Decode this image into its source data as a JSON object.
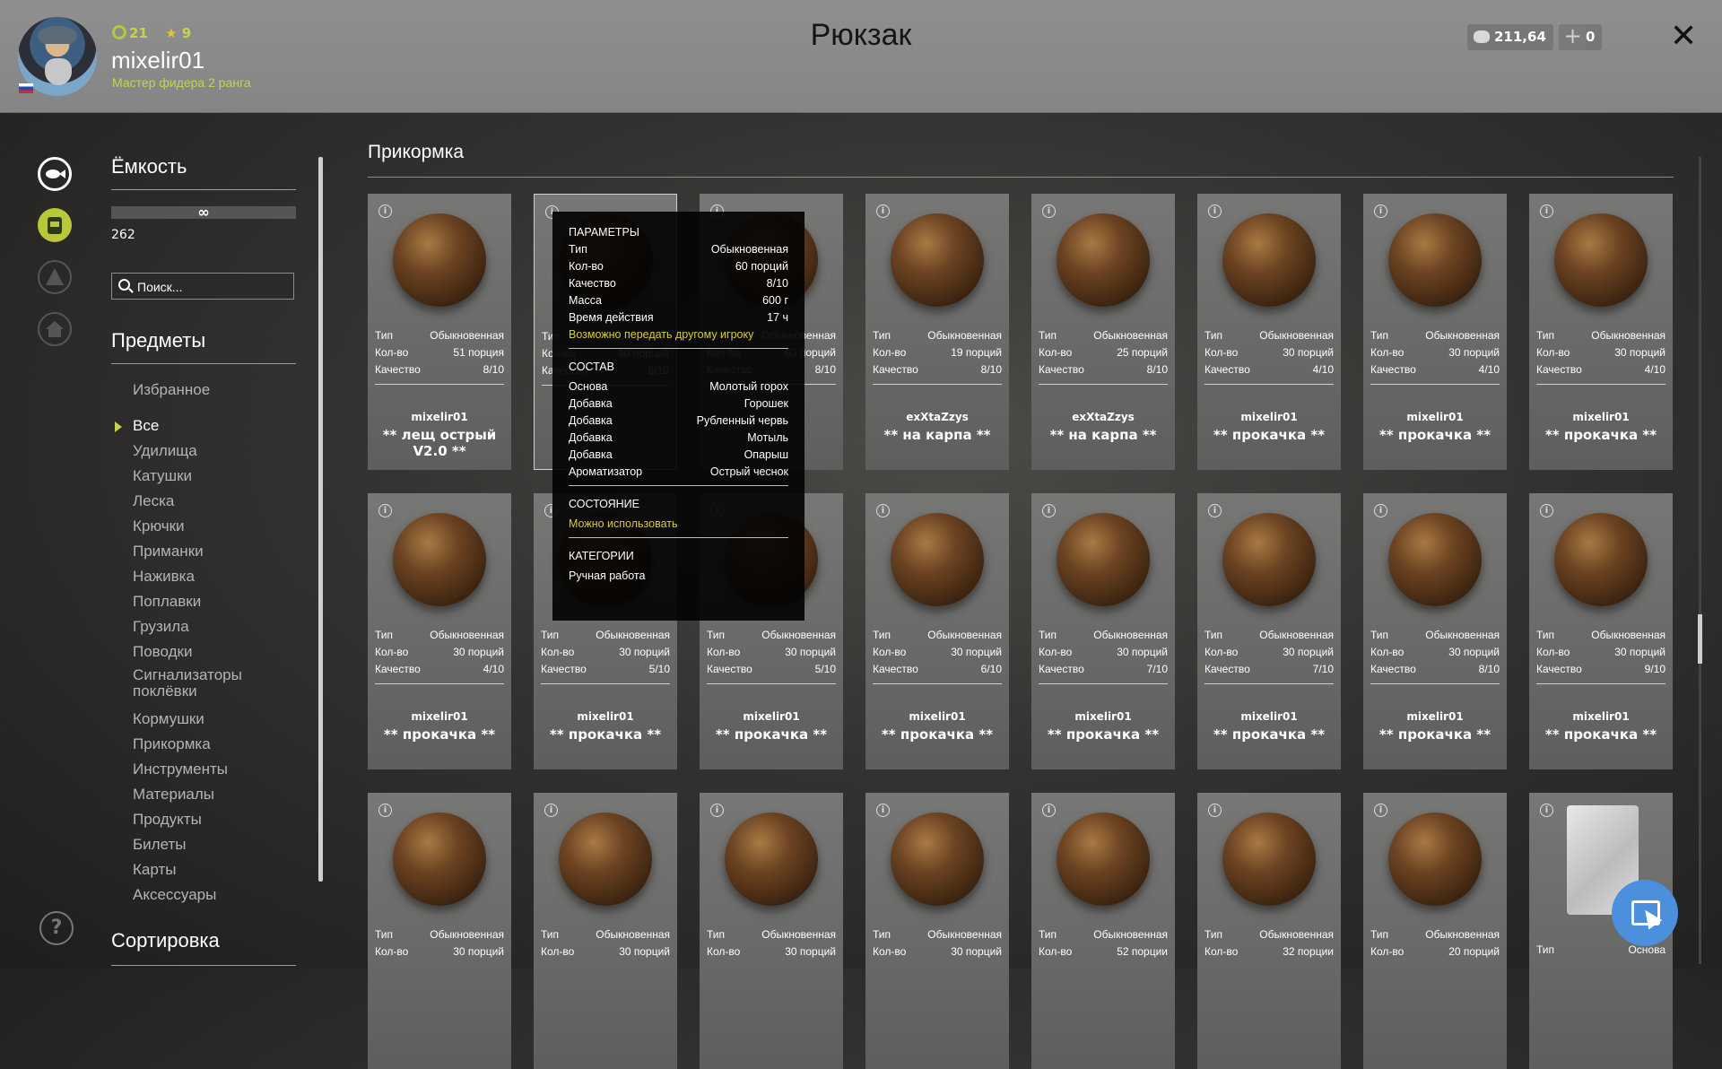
{
  "header": {
    "title": "Рюкзак",
    "level": "21",
    "stars": "9",
    "username": "mixelir01",
    "rank": "Мастер фидера 2 ранга",
    "silver": "211,64",
    "gold": "0",
    "plus_symbol": "+",
    "close_symbol": "✕",
    "colors": {
      "accent": "#c8d24b",
      "topbar": "#8a8a8a"
    }
  },
  "left_icons": [
    "fish-icon",
    "backpack-icon",
    "camp-icon",
    "home-icon"
  ],
  "sidebar": {
    "capacity_label": "Ёмкость",
    "capacity_infinity": "∞",
    "capacity_value": "262",
    "search_placeholder": "Поиск...",
    "items_label": "Предметы",
    "categories": [
      "Избранное",
      "Все",
      "Удилища",
      "Катушки",
      "Леска",
      "Крючки",
      "Приманки",
      "Наживка",
      "Поплавки",
      "Грузила",
      "Поводки",
      "Сигнализаторы поклёвки",
      "Кормушки",
      "Прикормка",
      "Инструменты",
      "Материалы",
      "Продукты",
      "Билеты",
      "Карты",
      "Аксессуары"
    ],
    "active_category": "Все",
    "sort_label": "Сортировка",
    "help_symbol": "?"
  },
  "section": {
    "title": "Прикормка"
  },
  "labels": {
    "type": "Тип",
    "count": "Кол-во",
    "quality": "Качество",
    "base": "Основа",
    "info": "i"
  },
  "cards": [
    {
      "type": "Обыкновенная",
      "count": "51 порция",
      "quality": "8/10",
      "author": "mixelir01",
      "name": "** лещ острый V2.0 **"
    },
    {
      "type": "Обыкновенная",
      "count": "60 порций",
      "quality": "8/10",
      "author": "",
      "name": ""
    },
    {
      "type": "Обыкновенная",
      "count": "60 порций",
      "quality": "8/10",
      "author": "",
      "name": "**"
    },
    {
      "type": "Обыкновенная",
      "count": "19 порций",
      "quality": "8/10",
      "author": "exXtaZzys",
      "name": "** на карпа **"
    },
    {
      "type": "Обыкновенная",
      "count": "25 порций",
      "quality": "8/10",
      "author": "exXtaZzys",
      "name": "** на карпа **"
    },
    {
      "type": "Обыкновенная",
      "count": "30 порций",
      "quality": "4/10",
      "author": "mixelir01",
      "name": "** прокачка **"
    },
    {
      "type": "Обыкновенная",
      "count": "30 порций",
      "quality": "4/10",
      "author": "mixelir01",
      "name": "** прокачка **"
    },
    {
      "type": "Обыкновенная",
      "count": "30 порций",
      "quality": "4/10",
      "author": "mixelir01",
      "name": "** прокачка **"
    },
    {
      "type": "Обыкновенная",
      "count": "30 порций",
      "quality": "4/10",
      "author": "mixelir01",
      "name": "** прокачка **"
    },
    {
      "type": "Обыкновенная",
      "count": "30 порций",
      "quality": "5/10",
      "author": "mixelir01",
      "name": "** прокачка **"
    },
    {
      "type": "Обыкновенная",
      "count": "30 порций",
      "quality": "5/10",
      "author": "mixelir01",
      "name": "** прокачка **"
    },
    {
      "type": "Обыкновенная",
      "count": "30 порций",
      "quality": "6/10",
      "author": "mixelir01",
      "name": "** прокачка **"
    },
    {
      "type": "Обыкновенная",
      "count": "30 порций",
      "quality": "7/10",
      "author": "mixelir01",
      "name": "** прокачка **"
    },
    {
      "type": "Обыкновенная",
      "count": "30 порций",
      "quality": "7/10",
      "author": "mixelir01",
      "name": "** прокачка **"
    },
    {
      "type": "Обыкновенная",
      "count": "30 порций",
      "quality": "8/10",
      "author": "mixelir01",
      "name": "** прокачка **"
    },
    {
      "type": "Обыкновенная",
      "count": "30 порций",
      "quality": "9/10",
      "author": "mixelir01",
      "name": "** прокачка **"
    },
    {
      "type": "Обыкновенная",
      "count": "30 порций"
    },
    {
      "type": "Обыкновенная",
      "count": "30 порций"
    },
    {
      "type": "Обыкновенная",
      "count": "30 порций"
    },
    {
      "type": "Обыкновенная",
      "count": "30 порций"
    },
    {
      "type": "Обыкновенная",
      "count": "52 порции"
    },
    {
      "type": "Обыкновенная",
      "count": "32 порции"
    },
    {
      "type": "Обыкновенная",
      "count": "20 порций"
    },
    {
      "type": "Основа",
      "bag": true
    }
  ],
  "tooltip": {
    "params_title": "ПАРАМЕТРЫ",
    "params": [
      {
        "k": "Тип",
        "v": "Обыкновенная"
      },
      {
        "k": "Кол-во",
        "v": "60 порций"
      },
      {
        "k": "Качество",
        "v": "8/10"
      },
      {
        "k": "Масса",
        "v": "600 г"
      },
      {
        "k": "Время действия",
        "v": "17 ч"
      }
    ],
    "transfer_note": "Возможно передать другому игроку",
    "composition_title": "СОСТАВ",
    "composition": [
      {
        "k": "Основа",
        "v": "Молотый горох"
      },
      {
        "k": "Добавка",
        "v": "Горошек"
      },
      {
        "k": "Добавка",
        "v": "Рубленный червь"
      },
      {
        "k": "Добавка",
        "v": "Мотыль"
      },
      {
        "k": "Добавка",
        "v": "Опарыш"
      },
      {
        "k": "Ароматизатор",
        "v": "Острый чеснок"
      }
    ],
    "state_title": "СОСТОЯНИЕ",
    "state_value": "Можно использовать",
    "categories_title": "КАТЕГОРИИ",
    "categories_value": "Ручная работа"
  }
}
